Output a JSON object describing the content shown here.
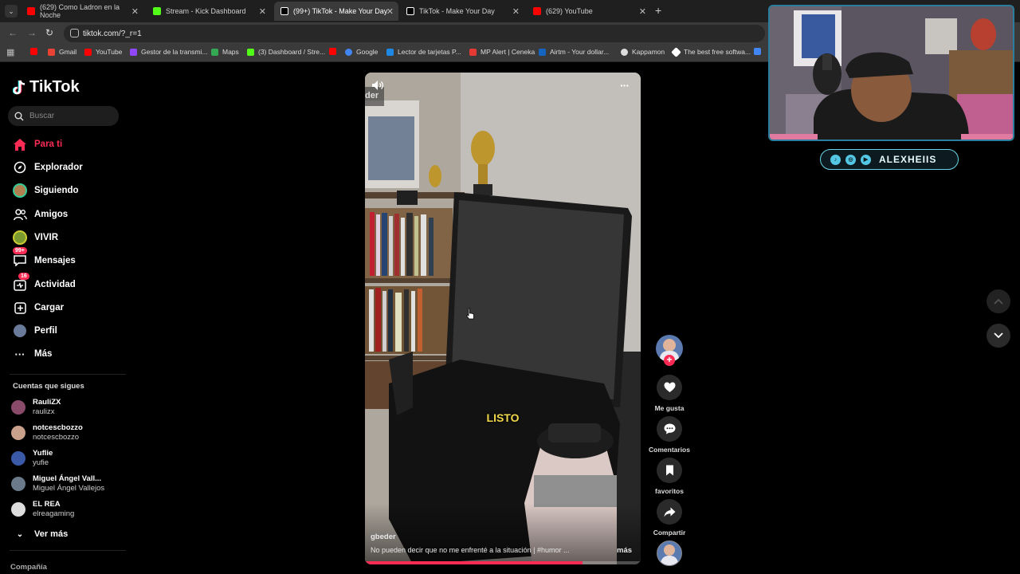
{
  "browser": {
    "tabs": [
      {
        "title": "(629) Como Ladron en la Noche",
        "favicon": "youtube-icon",
        "color": "#ff0000",
        "active": false
      },
      {
        "title": "Stream - Kick Dashboard",
        "favicon": "kick-icon",
        "color": "#53fc18",
        "active": false
      },
      {
        "title": "(99+) TikTok - Make Your Day",
        "favicon": "tiktok-icon",
        "color": "#ffffff",
        "active": true
      },
      {
        "title": "TikTok - Make Your Day",
        "favicon": "tiktok-icon",
        "color": "#ffffff",
        "active": false
      },
      {
        "title": "(629) YouTube",
        "favicon": "youtube-icon",
        "color": "#ff0000",
        "active": false
      }
    ],
    "new_tab": "+",
    "url": "tiktok.com/?_r=1",
    "bookmarks": [
      {
        "label": "",
        "color": "#ff0000"
      },
      {
        "label": "Gmail",
        "color": "#ea4335"
      },
      {
        "label": "YouTube",
        "color": "#ff0000"
      },
      {
        "label": "Gestor de la transmi...",
        "color": "#9146ff"
      },
      {
        "label": "Maps",
        "color": "#34a853"
      },
      {
        "label": "(3) Dashboard / Stre...",
        "color": "#53fc18"
      },
      {
        "label": "",
        "color": "#ff0000"
      },
      {
        "label": "Google",
        "color": "#4285f4"
      },
      {
        "label": "Lector de tarjetas P...",
        "color": "#1e88e5"
      },
      {
        "label": "MP Alert | Ceneka",
        "color": "#e53935"
      },
      {
        "label": "Airtm - Your dollar...",
        "color": "#1565c0"
      },
      {
        "label": "Kappamon",
        "color": "#dddddd"
      },
      {
        "label": "The best free softwa...",
        "color": "#ffffff"
      }
    ]
  },
  "sidebar": {
    "brand": "TikTok",
    "search_placeholder": "Buscar",
    "nav": [
      {
        "label": "Para ti",
        "icon": "home-icon",
        "active": true
      },
      {
        "label": "Explorador",
        "icon": "compass-icon"
      },
      {
        "label": "Siguiendo",
        "icon": "following-avatar-icon"
      },
      {
        "label": "Amigos",
        "icon": "friends-icon"
      },
      {
        "label": "VIVIR",
        "icon": "live-icon"
      },
      {
        "label": "Mensajes",
        "icon": "messages-icon",
        "badge": "99+"
      },
      {
        "label": "Actividad",
        "icon": "activity-icon",
        "badge": "16"
      },
      {
        "label": "Cargar",
        "icon": "upload-icon"
      },
      {
        "label": "Perfil",
        "icon": "profile-icon"
      },
      {
        "label": "Más",
        "icon": "more-icon"
      }
    ],
    "following_title": "Cuentas que sigues",
    "following": [
      {
        "name": "RauliZX",
        "handle": "raulizx",
        "color": "#8a4a6a"
      },
      {
        "name": "notcescbozzo",
        "handle": "notcescbozzo",
        "color": "#c9a08a"
      },
      {
        "name": "Yuflie",
        "handle": "yufie",
        "color": "#3a5aa8"
      },
      {
        "name": "Miguel Ángel Vall...",
        "handle": "Miguel Ángel Vallejos",
        "color": "#6a7a8a"
      },
      {
        "name": "EL REA",
        "handle": "elreagaming",
        "color": "#dddddd"
      }
    ],
    "see_more": "Ver más",
    "footer_section": "Compañía"
  },
  "video": {
    "username": "gbeder",
    "caption": "No pueden decir que no me enfrenté a la situación | #humor ...",
    "more": "más",
    "overlay_text": "LISTO",
    "corner_text": "der",
    "progress": 0.79
  },
  "actions": [
    {
      "label": "Me gusta",
      "icon": "heart-icon"
    },
    {
      "label": "Comentarios",
      "icon": "comment-icon"
    },
    {
      "label": "favoritos",
      "icon": "bookmark-icon"
    },
    {
      "label": "Compartir",
      "icon": "share-icon"
    }
  ],
  "stream_overlay": {
    "handle": "ALEXHEIIS"
  }
}
